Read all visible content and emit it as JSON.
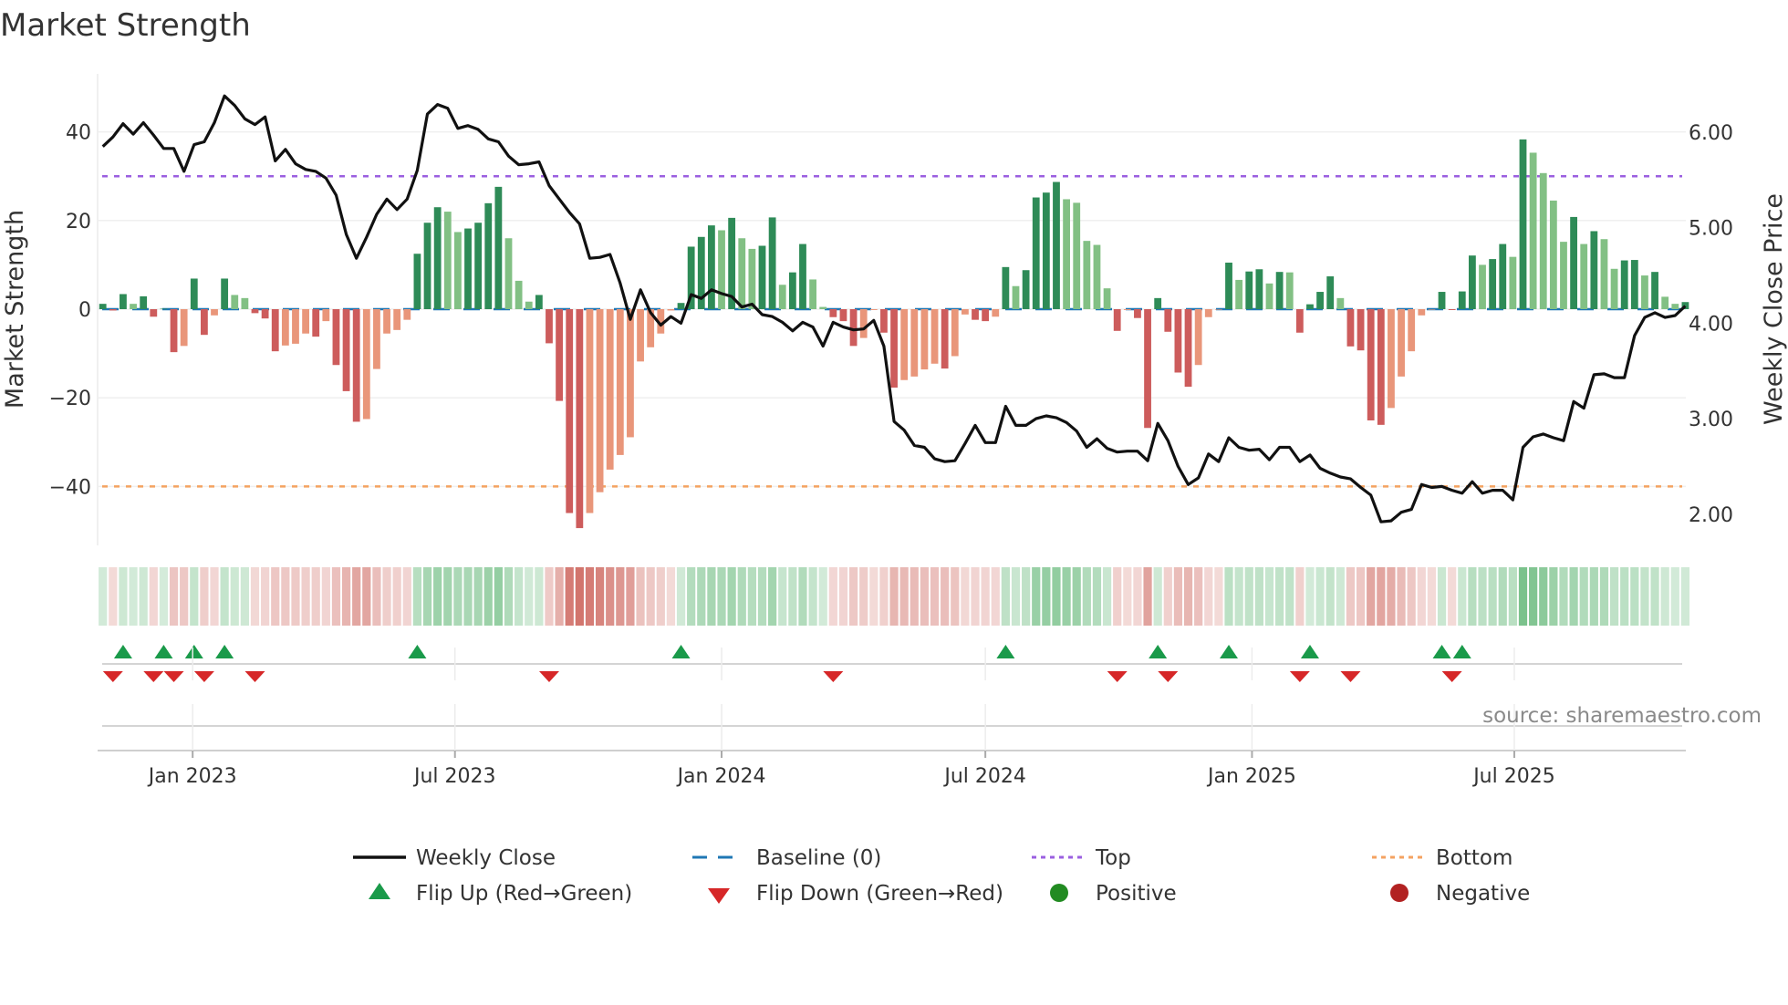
{
  "chart_data": {
    "type": "bar+line",
    "title": "Market Strength",
    "x": [
      "2022-10-31",
      "2022-11-07",
      "2022-11-14",
      "2022-11-21",
      "2022-11-28",
      "2022-12-05",
      "2022-12-12",
      "2022-12-19",
      "2022-12-26",
      "2023-01-02",
      "2023-01-09",
      "2023-01-16",
      "2023-01-23",
      "2023-01-30",
      "2023-02-06",
      "2023-02-13",
      "2023-02-20",
      "2023-02-27",
      "2023-03-06",
      "2023-03-13",
      "2023-03-20",
      "2023-03-27",
      "2023-04-03",
      "2023-04-10",
      "2023-04-17",
      "2023-04-24",
      "2023-05-01",
      "2023-05-08",
      "2023-05-15",
      "2023-05-22",
      "2023-05-29",
      "2023-06-05",
      "2023-06-12",
      "2023-06-19",
      "2023-06-26",
      "2023-07-03",
      "2023-07-10",
      "2023-07-17",
      "2023-07-24",
      "2023-07-31",
      "2023-08-07",
      "2023-08-14",
      "2023-08-21",
      "2023-08-28",
      "2023-09-04",
      "2023-09-11",
      "2023-09-18",
      "2023-09-25",
      "2023-10-02",
      "2023-10-09",
      "2023-10-16",
      "2023-10-23",
      "2023-10-30",
      "2023-11-06",
      "2023-11-13",
      "2023-11-20",
      "2023-11-27",
      "2023-12-04",
      "2023-12-11",
      "2023-12-18",
      "2023-12-25",
      "2024-01-01",
      "2024-01-08",
      "2024-01-15",
      "2024-01-22",
      "2024-01-29",
      "2024-02-05",
      "2024-02-12",
      "2024-02-19",
      "2024-02-26",
      "2024-03-04",
      "2024-03-11",
      "2024-03-18",
      "2024-03-25",
      "2024-04-01",
      "2024-04-08",
      "2024-04-15",
      "2024-04-22",
      "2024-04-29",
      "2024-05-06",
      "2024-05-13",
      "2024-05-20",
      "2024-05-27",
      "2024-06-03",
      "2024-06-10",
      "2024-06-17",
      "2024-06-24",
      "2024-07-01",
      "2024-07-08",
      "2024-07-15",
      "2024-07-22",
      "2024-07-29",
      "2024-08-05",
      "2024-08-12",
      "2024-08-19",
      "2024-08-26",
      "2024-09-02",
      "2024-09-09",
      "2024-09-16",
      "2024-09-23",
      "2024-09-30",
      "2024-10-07",
      "2024-10-14",
      "2024-10-21",
      "2024-10-28",
      "2024-11-04",
      "2024-11-11",
      "2024-11-18",
      "2024-11-25",
      "2024-12-02",
      "2024-12-09",
      "2024-12-16",
      "2024-12-23",
      "2024-12-30",
      "2025-01-06",
      "2025-01-13",
      "2025-01-20",
      "2025-01-27",
      "2025-02-03",
      "2025-02-10",
      "2025-02-17",
      "2025-02-24",
      "2025-03-03",
      "2025-03-10",
      "2025-03-17",
      "2025-03-24",
      "2025-03-31",
      "2025-04-07",
      "2025-04-14",
      "2025-04-21",
      "2025-04-28",
      "2025-05-05",
      "2025-05-12",
      "2025-05-19",
      "2025-05-26",
      "2025-06-02",
      "2025-06-09",
      "2025-06-16",
      "2025-06-23",
      "2025-06-30",
      "2025-07-07",
      "2025-07-14",
      "2025-07-21",
      "2025-07-28",
      "2025-08-04",
      "2025-08-11",
      "2025-08-18",
      "2025-08-25",
      "2025-09-01",
      "2025-09-08",
      "2025-09-15",
      "2025-09-22",
      "2025-09-29",
      "2025-10-06",
      "2025-10-13",
      "2025-10-20",
      "2025-10-27"
    ],
    "strength": [
      1.2,
      -0.3,
      3.4,
      1.2,
      2.9,
      -1.7,
      0.1,
      -9.7,
      -8.3,
      6.9,
      -5.8,
      -1.4,
      6.9,
      3.2,
      2.5,
      -0.9,
      -2.1,
      -9.5,
      -8.2,
      -7.8,
      -5.5,
      -6.2,
      -2.7,
      -12.6,
      -18.5,
      -25.4,
      -24.8,
      -13.5,
      -5.5,
      -4.7,
      -2.4,
      12.5,
      19.5,
      23,
      22,
      17.4,
      18.2,
      19.5,
      23.9,
      27.6,
      16,
      6.4,
      1.7,
      3.2,
      -7.7,
      -20.7,
      -46,
      -49.4,
      -46,
      -41.3,
      -36.2,
      -32.9,
      -28.9,
      -11.8,
      -8.6,
      -5.5,
      -0.3,
      1.4,
      14.1,
      16.3,
      18.9,
      17.8,
      20.6,
      16,
      13.6,
      14.3,
      20.7,
      5.5,
      8.3,
      14.7,
      6.7,
      0.5,
      -1.8,
      -2.7,
      -8.3,
      -6.5,
      -0.2,
      -5.3,
      -17.7,
      -16,
      -15.2,
      -13.6,
      -12.3,
      -13.4,
      -10.6,
      -1.2,
      -2.4,
      -2.7,
      -1.7,
      9.5,
      5.2,
      8.8,
      25.2,
      26.3,
      28.7,
      24.8,
      24,
      15.4,
      14.5,
      4.7,
      -4.9,
      -0.2,
      -2,
      -26.8,
      2.5,
      -5.1,
      -14.3,
      -17.5,
      -12.6,
      -1.8,
      -0.1,
      10.5,
      6.6,
      8.5,
      9,
      5.8,
      8.4,
      8.3,
      -5.3,
      1.1,
      3.9,
      7.4,
      2.5,
      -8.4,
      -9.3,
      -25.1,
      -26.1,
      -22.3,
      -15.2,
      -9.5,
      -1.4,
      -0.1,
      3.9,
      -0.2,
      4.0,
      12.1,
      10,
      11.3,
      14.7,
      11.8,
      38.3,
      35.3,
      30.7,
      24.5,
      15.2,
      20.8,
      14.7,
      17.6,
      15.8,
      9.1,
      11,
      11.1,
      7.6,
      8.4,
      2.8,
      1.2,
      1.6
    ],
    "weekly_close": {
      "name": "Weekly Close",
      "values": [
        5.85,
        5.95,
        6.09,
        5.98,
        6.1,
        5.97,
        5.83,
        5.83,
        5.59,
        5.87,
        5.9,
        6.1,
        6.38,
        6.28,
        6.14,
        6.08,
        6.16,
        5.7,
        5.82,
        5.67,
        5.61,
        5.59,
        5.52,
        5.34,
        4.93,
        4.68,
        4.9,
        5.14,
        5.3,
        5.19,
        5.3,
        5.6,
        6.19,
        6.29,
        6.25,
        6.04,
        6.07,
        6.03,
        5.93,
        5.9,
        5.75,
        5.66,
        5.67,
        5.69,
        5.44,
        5.3,
        5.16,
        5.04,
        4.68,
        4.69,
        4.72,
        4.42,
        4.04,
        4.35,
        4.11,
        3.98,
        4.07,
        4.0,
        4.3,
        4.26,
        4.35,
        4.31,
        4.28,
        4.17,
        4.2,
        4.09,
        4.07,
        4.01,
        3.92,
        4.01,
        3.96,
        3.76,
        4.01,
        3.96,
        3.93,
        3.94,
        4.03,
        3.76,
        2.97,
        2.88,
        2.72,
        2.7,
        2.58,
        2.55,
        2.56,
        2.74,
        2.93,
        2.75,
        2.75,
        3.13,
        2.93,
        2.93,
        3.0,
        3.03,
        3.01,
        2.96,
        2.87,
        2.7,
        2.79,
        2.69,
        2.65,
        2.66,
        2.66,
        2.56,
        2.95,
        2.77,
        2.5,
        2.31,
        2.38,
        2.63,
        2.55,
        2.8,
        2.7,
        2.67,
        2.68,
        2.57,
        2.7,
        2.7,
        2.55,
        2.62,
        2.48,
        2.43,
        2.39,
        2.37,
        2.28,
        2.2,
        1.92,
        1.93,
        2.02,
        2.05,
        2.31,
        2.28,
        2.29,
        2.25,
        2.22,
        2.34,
        2.22,
        2.25,
        2.25,
        2.15,
        2.7,
        2.81,
        2.84,
        2.8,
        2.77,
        3.18,
        3.11,
        3.46,
        3.47,
        3.43,
        3.43,
        3.87,
        4.06,
        4.11,
        4.06,
        4.08,
        4.18
      ]
    },
    "left_axis": {
      "label": "Market Strength",
      "ticks": [
        40,
        20,
        0,
        -20,
        -40
      ],
      "tick_labels": [
        "40",
        "20",
        "0",
        "−20",
        "−40"
      ]
    },
    "right_axis": {
      "label": "Weekly Close Price",
      "ticks": [
        6,
        5,
        4,
        3,
        2
      ],
      "tick_labels": [
        "6.00",
        "5.00",
        "4.00",
        "3.00",
        "2.00"
      ]
    },
    "x_ticks": [
      {
        "date": "2023-01-01",
        "label": "Jan 2023"
      },
      {
        "date": "2023-07-01",
        "label": "Jul 2023"
      },
      {
        "date": "2024-01-01",
        "label": "Jan 2024"
      },
      {
        "date": "2024-07-01",
        "label": "Jul 2024"
      },
      {
        "date": "2025-01-01",
        "label": "Jan 2025"
      },
      {
        "date": "2025-07-01",
        "label": "Jul 2025"
      }
    ],
    "reference_lines": {
      "baseline": 0,
      "top": 30,
      "bottom": -40
    },
    "grid": true,
    "legend_placement": "bottom",
    "colors": {
      "rising_positive": "#2e8b57",
      "falling_positive": "#82c084",
      "falling_negative": "#cd5c5c",
      "rising_negative": "#e9967a",
      "weekly_close": "#111111",
      "baseline": "#1f77b4",
      "top": "#9b5fe0",
      "bottom": "#f4a261",
      "flip_up": "#1a9a4a",
      "flip_down": "#d62728",
      "positive": "#228b22",
      "negative": "#b22222"
    }
  },
  "legend": {
    "weekly_close": "Weekly Close",
    "baseline": "Baseline (0)",
    "top": "Top",
    "bottom": "Bottom",
    "flip_up": "Flip Up (Red→Green)",
    "flip_down": "Flip Down (Green→Red)",
    "positive": "Positive",
    "negative": "Negative"
  },
  "source": "source: sharemaestro.com"
}
